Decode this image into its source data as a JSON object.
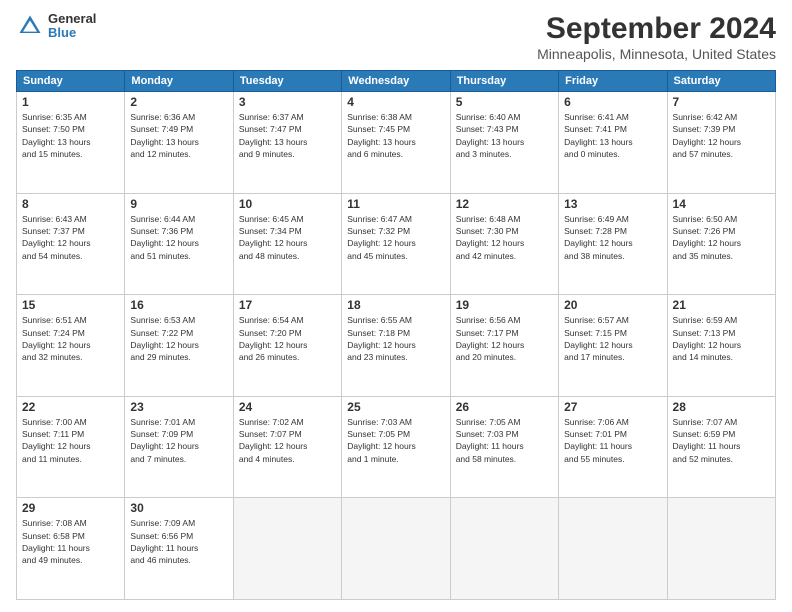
{
  "header": {
    "logo_general": "General",
    "logo_blue": "Blue",
    "main_title": "September 2024",
    "subtitle": "Minneapolis, Minnesota, United States"
  },
  "weekdays": [
    "Sunday",
    "Monday",
    "Tuesday",
    "Wednesday",
    "Thursday",
    "Friday",
    "Saturday"
  ],
  "weeks": [
    [
      {
        "day": "1",
        "info": "Sunrise: 6:35 AM\nSunset: 7:50 PM\nDaylight: 13 hours\nand 15 minutes."
      },
      {
        "day": "2",
        "info": "Sunrise: 6:36 AM\nSunset: 7:49 PM\nDaylight: 13 hours\nand 12 minutes."
      },
      {
        "day": "3",
        "info": "Sunrise: 6:37 AM\nSunset: 7:47 PM\nDaylight: 13 hours\nand 9 minutes."
      },
      {
        "day": "4",
        "info": "Sunrise: 6:38 AM\nSunset: 7:45 PM\nDaylight: 13 hours\nand 6 minutes."
      },
      {
        "day": "5",
        "info": "Sunrise: 6:40 AM\nSunset: 7:43 PM\nDaylight: 13 hours\nand 3 minutes."
      },
      {
        "day": "6",
        "info": "Sunrise: 6:41 AM\nSunset: 7:41 PM\nDaylight: 13 hours\nand 0 minutes."
      },
      {
        "day": "7",
        "info": "Sunrise: 6:42 AM\nSunset: 7:39 PM\nDaylight: 12 hours\nand 57 minutes."
      }
    ],
    [
      {
        "day": "8",
        "info": "Sunrise: 6:43 AM\nSunset: 7:37 PM\nDaylight: 12 hours\nand 54 minutes."
      },
      {
        "day": "9",
        "info": "Sunrise: 6:44 AM\nSunset: 7:36 PM\nDaylight: 12 hours\nand 51 minutes."
      },
      {
        "day": "10",
        "info": "Sunrise: 6:45 AM\nSunset: 7:34 PM\nDaylight: 12 hours\nand 48 minutes."
      },
      {
        "day": "11",
        "info": "Sunrise: 6:47 AM\nSunset: 7:32 PM\nDaylight: 12 hours\nand 45 minutes."
      },
      {
        "day": "12",
        "info": "Sunrise: 6:48 AM\nSunset: 7:30 PM\nDaylight: 12 hours\nand 42 minutes."
      },
      {
        "day": "13",
        "info": "Sunrise: 6:49 AM\nSunset: 7:28 PM\nDaylight: 12 hours\nand 38 minutes."
      },
      {
        "day": "14",
        "info": "Sunrise: 6:50 AM\nSunset: 7:26 PM\nDaylight: 12 hours\nand 35 minutes."
      }
    ],
    [
      {
        "day": "15",
        "info": "Sunrise: 6:51 AM\nSunset: 7:24 PM\nDaylight: 12 hours\nand 32 minutes."
      },
      {
        "day": "16",
        "info": "Sunrise: 6:53 AM\nSunset: 7:22 PM\nDaylight: 12 hours\nand 29 minutes."
      },
      {
        "day": "17",
        "info": "Sunrise: 6:54 AM\nSunset: 7:20 PM\nDaylight: 12 hours\nand 26 minutes."
      },
      {
        "day": "18",
        "info": "Sunrise: 6:55 AM\nSunset: 7:18 PM\nDaylight: 12 hours\nand 23 minutes."
      },
      {
        "day": "19",
        "info": "Sunrise: 6:56 AM\nSunset: 7:17 PM\nDaylight: 12 hours\nand 20 minutes."
      },
      {
        "day": "20",
        "info": "Sunrise: 6:57 AM\nSunset: 7:15 PM\nDaylight: 12 hours\nand 17 minutes."
      },
      {
        "day": "21",
        "info": "Sunrise: 6:59 AM\nSunset: 7:13 PM\nDaylight: 12 hours\nand 14 minutes."
      }
    ],
    [
      {
        "day": "22",
        "info": "Sunrise: 7:00 AM\nSunset: 7:11 PM\nDaylight: 12 hours\nand 11 minutes."
      },
      {
        "day": "23",
        "info": "Sunrise: 7:01 AM\nSunset: 7:09 PM\nDaylight: 12 hours\nand 7 minutes."
      },
      {
        "day": "24",
        "info": "Sunrise: 7:02 AM\nSunset: 7:07 PM\nDaylight: 12 hours\nand 4 minutes."
      },
      {
        "day": "25",
        "info": "Sunrise: 7:03 AM\nSunset: 7:05 PM\nDaylight: 12 hours\nand 1 minute."
      },
      {
        "day": "26",
        "info": "Sunrise: 7:05 AM\nSunset: 7:03 PM\nDaylight: 11 hours\nand 58 minutes."
      },
      {
        "day": "27",
        "info": "Sunrise: 7:06 AM\nSunset: 7:01 PM\nDaylight: 11 hours\nand 55 minutes."
      },
      {
        "day": "28",
        "info": "Sunrise: 7:07 AM\nSunset: 6:59 PM\nDaylight: 11 hours\nand 52 minutes."
      }
    ],
    [
      {
        "day": "29",
        "info": "Sunrise: 7:08 AM\nSunset: 6:58 PM\nDaylight: 11 hours\nand 49 minutes."
      },
      {
        "day": "30",
        "info": "Sunrise: 7:09 AM\nSunset: 6:56 PM\nDaylight: 11 hours\nand 46 minutes."
      },
      {
        "day": "",
        "info": ""
      },
      {
        "day": "",
        "info": ""
      },
      {
        "day": "",
        "info": ""
      },
      {
        "day": "",
        "info": ""
      },
      {
        "day": "",
        "info": ""
      }
    ]
  ]
}
